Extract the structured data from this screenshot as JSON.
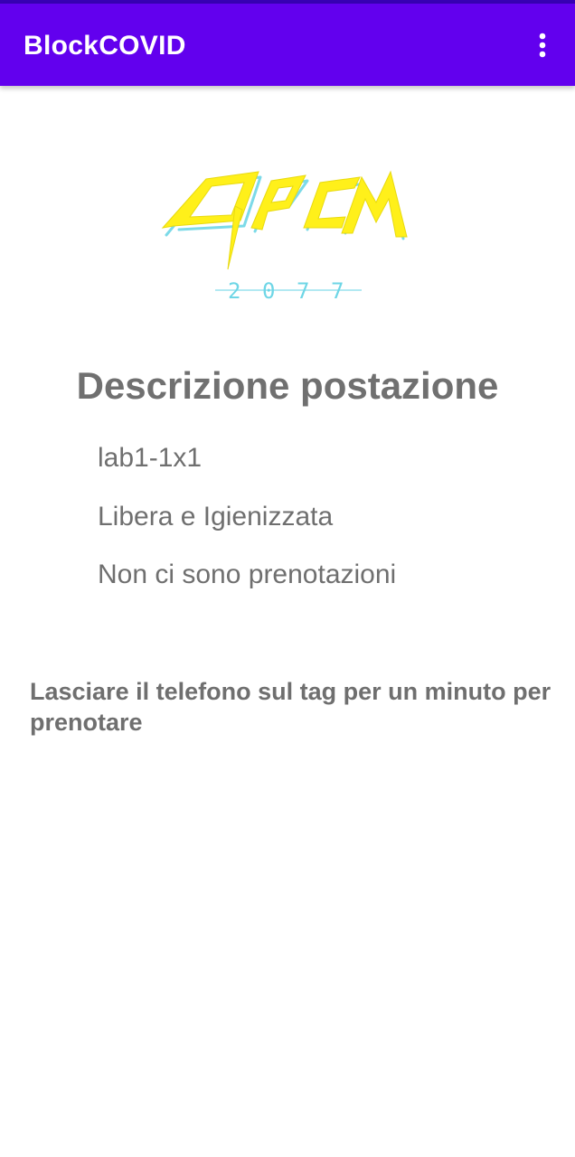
{
  "app_bar": {
    "title": "BlockCOVID",
    "menu_icon": "more-vert-icon",
    "background_color": "#6200EE",
    "status_color": "#3700B3"
  },
  "logo": {
    "text": "DPCM",
    "subtext": "2077",
    "colors": {
      "primary": "#FFF01A",
      "accent": "#6ED6E6"
    }
  },
  "main": {
    "heading": "Descrizione postazione",
    "station_id": "lab1-1x1",
    "status": "Libera e Igienizzata",
    "reservations": "Non ci sono prenotazioni",
    "instruction": "Lasciare il telefono sul tag per un minuto per prenotare"
  }
}
